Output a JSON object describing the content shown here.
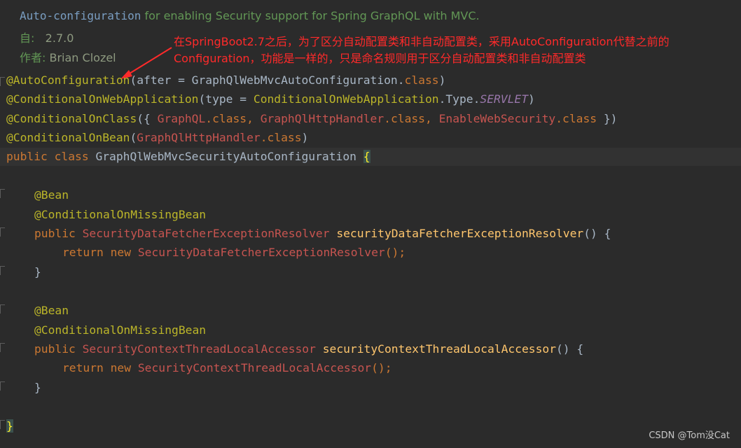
{
  "javadoc": {
    "line1_code": "Auto-configuration",
    "line1_text": " for enabling Security support for Spring GraphQL with MVC.",
    "since_label": "自:",
    "since_value": "2.7.0",
    "author_label": "作者:",
    "author_value": "Brian Clozel"
  },
  "annotation_note": {
    "line1": "在SpringBoot2.7之后，为了区分自动配置类和非自动配置类，采用AutoConfiguration代替之前的",
    "line2": "Configuration，功能是一样的，只是命名规则用于区分自动配置类和非自动配置类"
  },
  "code": {
    "l1_ann": "@AutoConfiguration",
    "l1_rest": "(after = GraphQlWebMvcAutoConfiguration.",
    "l1_class": "class",
    "l1_end": ")",
    "l2_ann": "@ConditionalOnWebApplication",
    "l2_a": "(type = ",
    "l2_cls": "ConditionalOnWebApplication",
    "l2_b": ".Type.",
    "l2_enum": "SERVLET",
    "l2_end": ")",
    "l3_ann": "@ConditionalOnClass",
    "l3_a": "({ ",
    "l3_t1": "GraphQL",
    "l3_t1c": ".class, ",
    "l3_t2": "GraphQlHttpHandler",
    "l3_t2c": ".class, ",
    "l3_t3": "EnableWebSecurity",
    "l3_t3c": ".class",
    "l3_end": " })",
    "l4_ann": "@ConditionalOnBean",
    "l4_a": "(",
    "l4_t": "GraphQlHttpHandler",
    "l4_c": ".class",
    "l4_end": ")",
    "l5_kw": "public class ",
    "l5_name": "GraphQlWebMvcSecurityAutoConfiguration ",
    "l5_brace": "{",
    "bean": "@Bean",
    "missing": "@ConditionalOnMissingBean",
    "public_kw": "public ",
    "m1_type": "SecurityDataFetcherExceptionResolver",
    "m1_name": "securityDataFetcherExceptionResolver",
    "m1_sig": "() {",
    "return_kw": "return new ",
    "m1_ctor": "SecurityDataFetcherExceptionResolver",
    "ctor_end": "();",
    "close": "}",
    "m2_type": "SecurityContextThreadLocalAccessor",
    "m2_name": "securityContextThreadLocalAccessor",
    "m2_sig": "() {",
    "m2_ctor": "SecurityContextThreadLocalAccessor",
    "final_close": "}"
  },
  "watermark": "CSDN @Tom没Cat",
  "colors": {
    "background": "#2b2b2b",
    "annotation": "#bbb529",
    "keyword": "#cc7832",
    "method": "#ffc66d",
    "error_type": "#c75450",
    "note_red": "#ff2a2a"
  }
}
